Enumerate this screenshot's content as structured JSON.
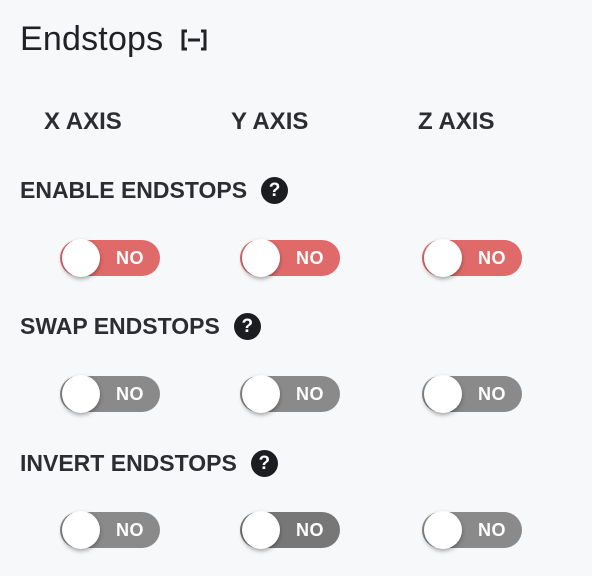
{
  "panel": {
    "title": "Endstops",
    "collapse_icon": "collapse-bracket-minus-icon"
  },
  "axes": {
    "x": "X AXIS",
    "y": "Y AXIS",
    "z": "Z AXIS"
  },
  "sections": [
    {
      "label": "ENABLE ENDSTOPS",
      "help_icon": "help-circle-icon",
      "help_glyph": "?",
      "toggles": [
        {
          "axis": "x",
          "value": "NO",
          "state": "off",
          "color": "#e06a69"
        },
        {
          "axis": "y",
          "value": "NO",
          "state": "off",
          "color": "#e06a69"
        },
        {
          "axis": "z",
          "value": "NO",
          "state": "off",
          "color": "#e06a69"
        }
      ]
    },
    {
      "label": "SWAP ENDSTOPS",
      "help_icon": "help-circle-icon",
      "help_glyph": "?",
      "toggles": [
        {
          "axis": "x",
          "value": "NO",
          "state": "off",
          "color": "#8a8a8a"
        },
        {
          "axis": "y",
          "value": "NO",
          "state": "off",
          "color": "#8a8a8a"
        },
        {
          "axis": "z",
          "value": "NO",
          "state": "off",
          "color": "#8a8a8a"
        }
      ]
    },
    {
      "label": "INVERT ENDSTOPS",
      "help_icon": "help-circle-icon",
      "help_glyph": "?",
      "toggles": [
        {
          "axis": "x",
          "value": "NO",
          "state": "off",
          "color": "#8a8a8a"
        },
        {
          "axis": "y",
          "value": "NO",
          "state": "off",
          "color": "#777777"
        },
        {
          "axis": "z",
          "value": "NO",
          "state": "off",
          "color": "#8a8a8a"
        }
      ]
    }
  ],
  "colors": {
    "background": "#f7f8fa",
    "enable_toggle": "#e06a69",
    "neutral_toggle": "#8a8a8a",
    "help_icon_bg": "#1b1d20",
    "text": "#2b2d31"
  }
}
